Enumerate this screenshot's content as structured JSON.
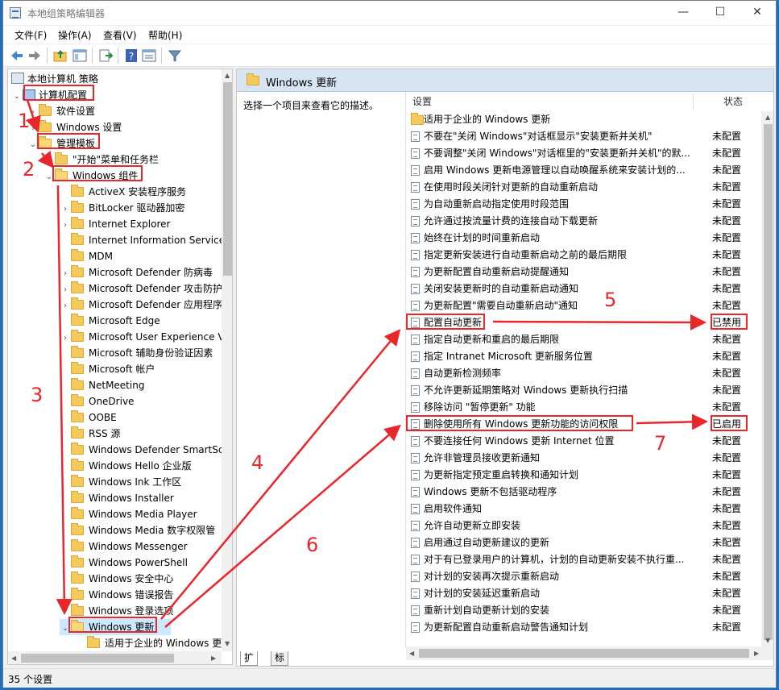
{
  "window": {
    "title": "本地组策略编辑器",
    "min": "—",
    "max": "☐",
    "close": "✕"
  },
  "menu": {
    "file": "文件(F)",
    "action": "操作(A)",
    "view": "查看(V)",
    "help": "帮助(H)"
  },
  "tree": {
    "root": "本地计算机 策略",
    "computer_config": "计算机配置",
    "software_settings": "软件设置",
    "windows_settings": "Windows 设置",
    "admin_templates": "管理模板",
    "start_menu": "\"开始\"菜单和任务栏",
    "windows_components": "Windows 组件",
    "items": [
      "ActiveX 安装程序服务",
      "BitLocker 驱动器加密",
      "Internet Explorer",
      "Internet Information Service",
      "MDM",
      "Microsoft Defender 防病毒",
      "Microsoft Defender 攻击防护",
      "Microsoft Defender 应用程序",
      "Microsoft Edge",
      "Microsoft User Experience V",
      "Microsoft 辅助身份验证因素",
      "Microsoft 帐户",
      "NetMeeting",
      "OneDrive",
      "OOBE",
      "RSS 源",
      "Windows Defender SmartSc",
      "Windows Hello 企业版",
      "Windows Ink 工作区",
      "Windows Installer",
      "Windows Media Player",
      "Windows Media 数字权限管",
      "Windows Messenger",
      "Windows PowerShell",
      "Windows 安全中心",
      "Windows 错误报告",
      "Windows 登录选项"
    ],
    "windows_update": "Windows 更新",
    "enterprise": "适用于企业的 Windows 更新"
  },
  "right": {
    "header": "Windows 更新",
    "description": "选择一个项目来查看它的描述。",
    "col_setting": "设置",
    "col_state": "状态",
    "folder_row": "适用于企业的 Windows 更新",
    "policies": [
      {
        "name": "不要在\"关闭 Windows\"对话框显示\"安装更新并关机\"",
        "state": "未配置"
      },
      {
        "name": "不要调整\"关闭 Windows\"对话框里的\"安装更新并关机\"的默...",
        "state": "未配置"
      },
      {
        "name": "启用 Windows 更新电源管理以自动唤醒系统来安装计划的...",
        "state": "未配置"
      },
      {
        "name": "在使用时段关闭针对更新的自动重新启动",
        "state": "未配置"
      },
      {
        "name": "为自动重新启动指定使用时段范围",
        "state": "未配置"
      },
      {
        "name": "允许通过按流量计费的连接自动下载更新",
        "state": "未配置"
      },
      {
        "name": "始终在计划的时间重新启动",
        "state": "未配置"
      },
      {
        "name": "指定更新安装进行自动重新启动之前的最后期限",
        "state": "未配置"
      },
      {
        "name": "为更新配置自动重新启动提醒通知",
        "state": "未配置"
      },
      {
        "name": "关闭安装更新时的自动重新启动通知",
        "state": "未配置"
      },
      {
        "name": "为更新配置\"需要自动重新启动\"通知",
        "state": "未配置"
      },
      {
        "name": "配置自动更新",
        "state": "已禁用"
      },
      {
        "name": "指定自动更新和重启的最后期限",
        "state": "未配置"
      },
      {
        "name": "指定 Intranet Microsoft 更新服务位置",
        "state": "未配置"
      },
      {
        "name": "自动更新检测频率",
        "state": "未配置"
      },
      {
        "name": "不允许更新延期策略对 Windows 更新执行扫描",
        "state": "未配置"
      },
      {
        "name": "移除访问 \"暂停更新\" 功能",
        "state": "未配置"
      },
      {
        "name": "删除使用所有 Windows 更新功能的访问权限",
        "state": "已启用"
      },
      {
        "name": "不要连接任何 Windows 更新 Internet 位置",
        "state": "未配置"
      },
      {
        "name": "允许非管理员接收更新通知",
        "state": "未配置"
      },
      {
        "name": "为更新指定预定重启转换和通知计划",
        "state": "未配置"
      },
      {
        "name": "Windows 更新不包括驱动程序",
        "state": "未配置"
      },
      {
        "name": "启用软件通知",
        "state": "未配置"
      },
      {
        "name": "允许自动更新立即安装",
        "state": "未配置"
      },
      {
        "name": "启用通过自动更新建议的更新",
        "state": "未配置"
      },
      {
        "name": "对于有已登录用户的计算机，计划的自动更新安装不执行重...",
        "state": "未配置"
      },
      {
        "name": "对计划的安装再次提示重新启动",
        "state": "未配置"
      },
      {
        "name": "对计划的安装延迟重新启动",
        "state": "未配置"
      },
      {
        "name": "重新计划自动更新计划的安装",
        "state": "未配置"
      },
      {
        "name": "为更新配置自动重新启动警告通知计划",
        "state": "未配置"
      }
    ],
    "tabs": [
      "扩展",
      "标准"
    ]
  },
  "status": "35 个设置",
  "annotations": [
    "1",
    "2",
    "3",
    "4",
    "5",
    "6",
    "7"
  ],
  "colors": {
    "annotation": "#e8262b",
    "selection": "#cce8ff",
    "header_bg": "#d7e4f1"
  }
}
